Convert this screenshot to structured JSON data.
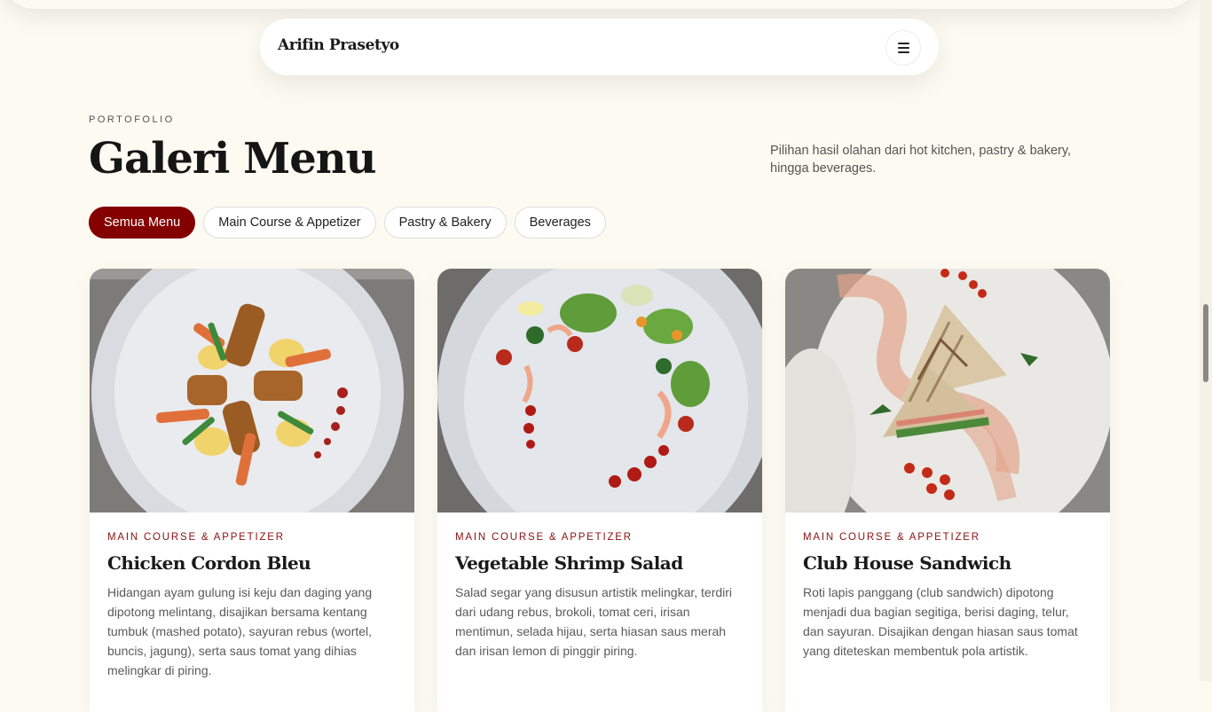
{
  "nav": {
    "brand": "Arifin Prasetyo",
    "menu_icon": "hamburger-icon"
  },
  "section": {
    "eyebrow": "PORTOFOLIO",
    "title": "Galeri Menu",
    "description": "Pilihan hasil olahan dari hot kitchen, pastry & bakery, hingga beverages."
  },
  "filters": [
    {
      "label": "Semua Menu",
      "active": true
    },
    {
      "label": "Main Course & Appetizer",
      "active": false
    },
    {
      "label": "Pastry & Bakery",
      "active": false
    },
    {
      "label": "Beverages",
      "active": false
    }
  ],
  "cards": [
    {
      "category": "MAIN COURSE & APPETIZER",
      "title": "Chicken Cordon Bleu",
      "description": "Hidangan ayam gulung isi keju dan daging yang dipotong melintang, disajikan bersama kentang tumbuk (mashed potato), sayuran rebus (wortel, buncis, jagung), serta saus tomat yang dihias melingkar di piring."
    },
    {
      "category": "MAIN COURSE & APPETIZER",
      "title": "Vegetable Shrimp Salad",
      "description": "Salad segar yang disusun artistik melingkar, terdiri dari udang rebus, brokoli, tomat ceri, irisan mentimun, selada hijau, serta hiasan saus merah dan irisan lemon di pinggir piring."
    },
    {
      "category": "MAIN COURSE & APPETIZER",
      "title": "Club House Sandwich",
      "description": "Roti lapis panggang (club sandwich) dipotong menjadi dua bagian segitiga, berisi daging, telur, dan sayuran. Disajikan dengan hiasan saus tomat yang diteteskan membentuk pola artistik."
    }
  ],
  "colors": {
    "accent": "#840000",
    "background": "#fdfaf1",
    "category_text": "#8b0f0f"
  }
}
